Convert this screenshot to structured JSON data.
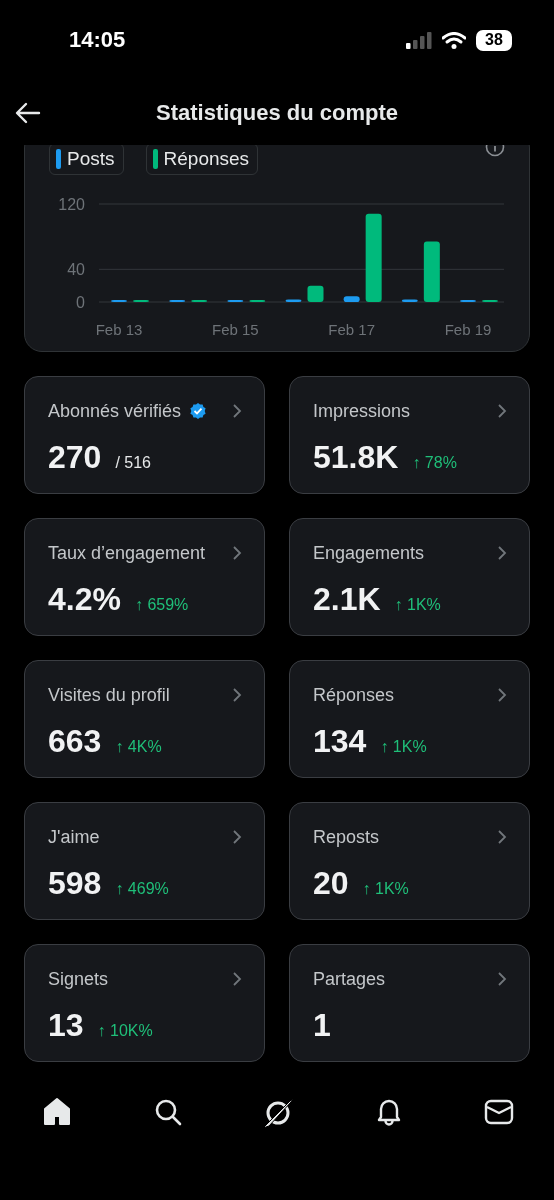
{
  "status_bar": {
    "time": "14:05",
    "battery": "38"
  },
  "header": {
    "title": "Statistiques du compte"
  },
  "chart": {
    "chart_data": {
      "type": "bar",
      "categories": [
        "Feb 13",
        null,
        "Feb 15",
        null,
        "Feb 17",
        null,
        "Feb 19"
      ],
      "yticks": [
        0,
        40,
        120
      ],
      "ylim": [
        0,
        120
      ],
      "series": [
        {
          "name": "Posts",
          "color": "#1d9bf0",
          "values": [
            0,
            0,
            0,
            3,
            7,
            3,
            1
          ]
        },
        {
          "name": "Réponses",
          "color": "#00ba7c",
          "values": [
            1,
            1,
            0,
            20,
            108,
            74,
            2
          ]
        }
      ]
    }
  },
  "cards": [
    {
      "title": "Abonnés vérifiés",
      "verified": true,
      "value": "270",
      "total": "/ 516"
    },
    {
      "title": "Impressions",
      "value": "51.8K",
      "change": "↑ 78%"
    },
    {
      "title": "Taux d’engagement",
      "value": "4.2%",
      "change": "↑ 659%"
    },
    {
      "title": "Engagements",
      "value": "2.1K",
      "change": "↑ 1K%"
    },
    {
      "title": "Visites du profil",
      "value": "663",
      "change": "↑ 4K%"
    },
    {
      "title": "Réponses",
      "value": "134",
      "change": "↑ 1K%"
    },
    {
      "title": "J'aime",
      "value": "598",
      "change": "↑ 469%"
    },
    {
      "title": "Reposts",
      "value": "20",
      "change": "↑ 1K%"
    },
    {
      "title": "Signets",
      "value": "13",
      "change": "↑ 10K%"
    },
    {
      "title": "Partages",
      "value": "1"
    }
  ],
  "tab_bar": [
    {
      "kind": "home",
      "selected": true
    },
    {
      "kind": "search",
      "selected": false
    },
    {
      "kind": "grok",
      "selected": false
    },
    {
      "kind": "bell",
      "selected": false
    },
    {
      "kind": "mail",
      "selected": false
    }
  ]
}
